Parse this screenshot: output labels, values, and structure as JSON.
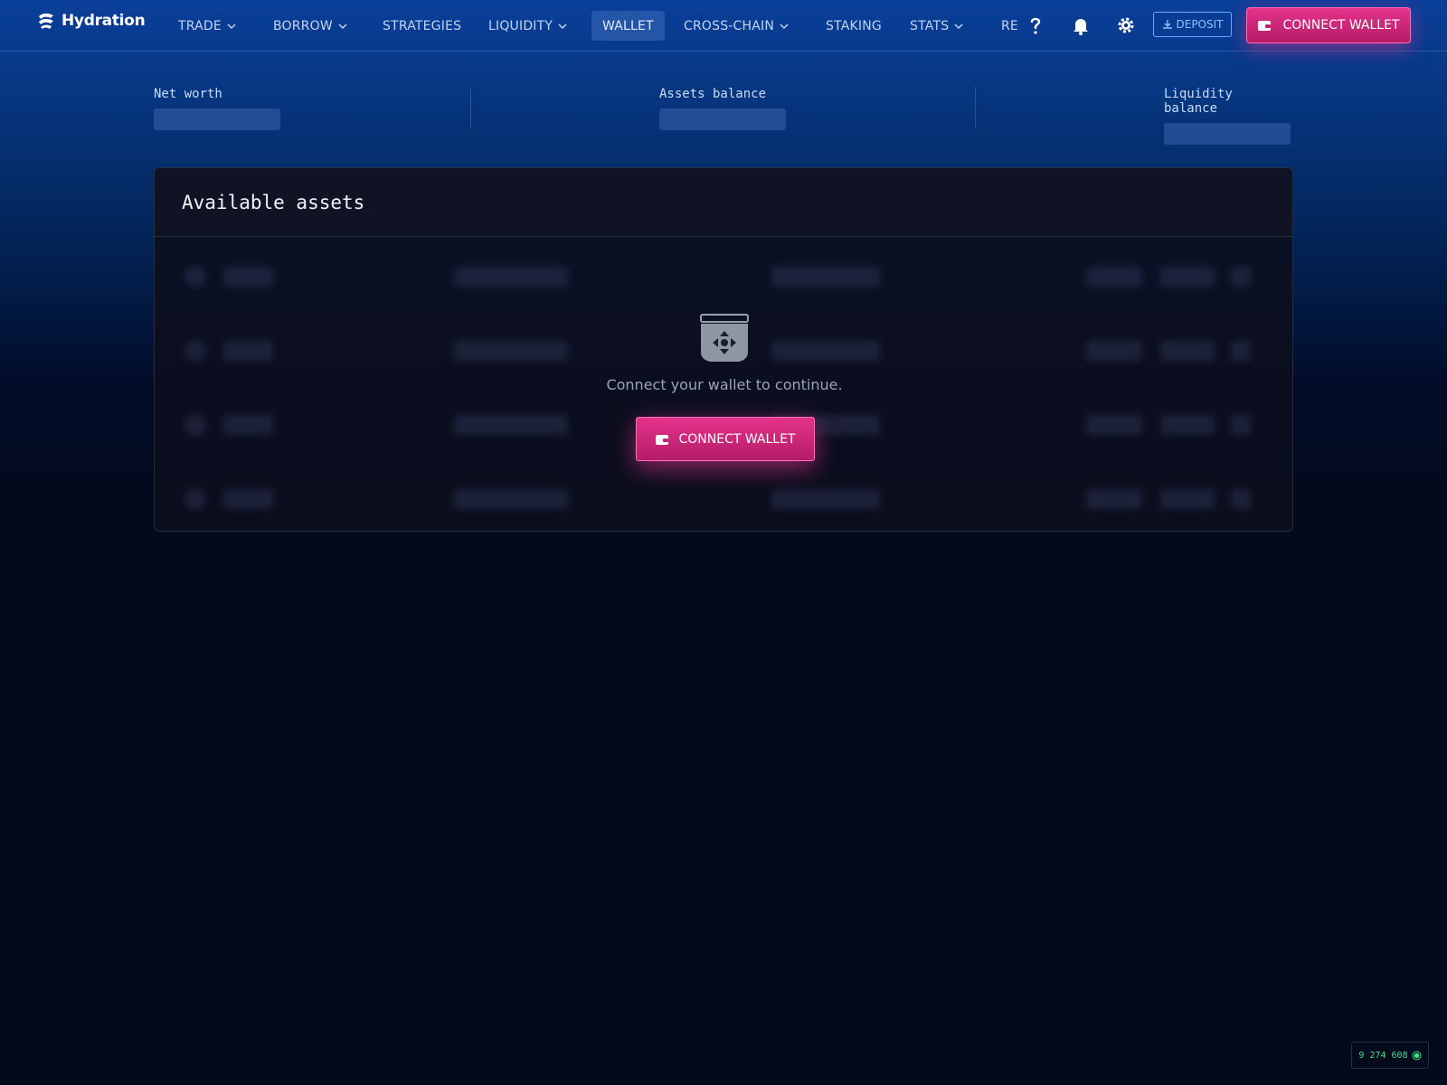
{
  "app": {
    "name": "Hydration"
  },
  "nav": {
    "items": [
      {
        "label": "TRADE",
        "has_dropdown": true
      },
      {
        "label": "BORROW",
        "has_dropdown": true
      },
      {
        "label": "STRATEGIES",
        "has_dropdown": false
      },
      {
        "label": "LIQUIDITY",
        "has_dropdown": true
      },
      {
        "label": "WALLET",
        "has_dropdown": false,
        "active": true
      },
      {
        "label": "CROSS-CHAIN",
        "has_dropdown": true
      },
      {
        "label": "STAKING",
        "has_dropdown": false
      },
      {
        "label": "STATS",
        "has_dropdown": true
      },
      {
        "label": "RE",
        "has_dropdown": false
      }
    ],
    "icons": [
      "help-icon",
      "bell-icon",
      "gear-icon"
    ],
    "deposit_label": "DEPOSIT",
    "connect_label": "CONNECT WALLET"
  },
  "stats": [
    {
      "label": "Net worth"
    },
    {
      "label": "Assets balance"
    },
    {
      "label": "Liquidity balance"
    }
  ],
  "assets": {
    "title": "Available assets",
    "empty_message": "Connect your wallet to continue.",
    "connect_label": "CONNECT WALLET"
  },
  "footer": {
    "block_number": "9 274 608"
  },
  "colors": {
    "accent": "#e4338a",
    "link": "#8fc0ff",
    "status": "#3ee08f"
  }
}
